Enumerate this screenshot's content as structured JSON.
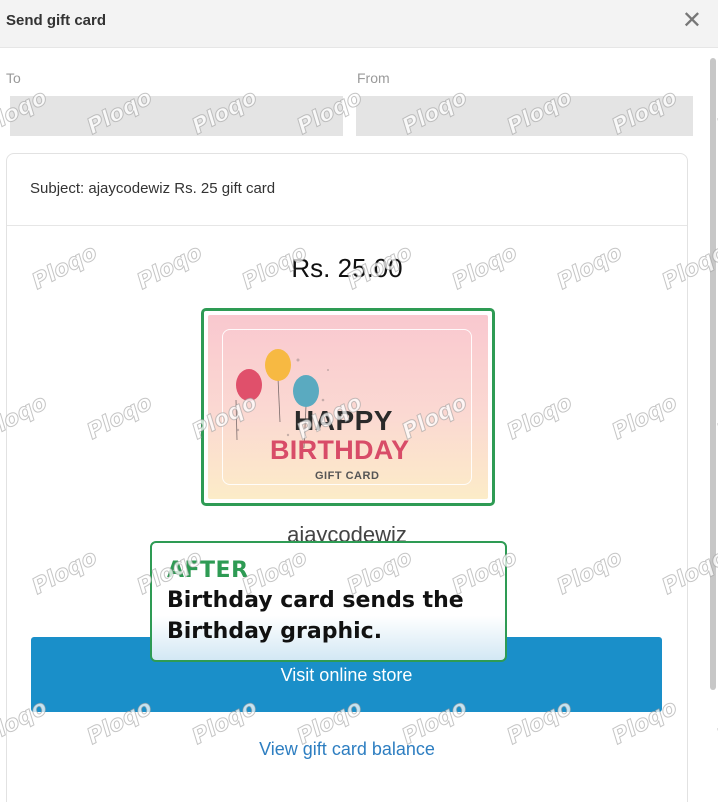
{
  "dialog": {
    "title": "Send gift card",
    "close_icon": "close-icon"
  },
  "form": {
    "to_label": "To",
    "to_value": "",
    "from_label": "From",
    "from_value": ""
  },
  "email_preview": {
    "subject": "Subject: ajaycodewiz Rs. 25 gift card",
    "amount": "Rs. 25.00",
    "gift_card": {
      "happy": "HAPPY",
      "birthday": "BIRTHDAY",
      "label": "GIFT CARD",
      "balloon_colors": [
        "#e0506b",
        "#f7b942",
        "#5aaac0"
      ]
    },
    "store_name": "ajaycodewiz",
    "visit_button": "Visit online store",
    "balance_link": "View gift card balance"
  },
  "annotation": {
    "tag": "AFTER",
    "note": "Birthday card sends the Birthday graphic.",
    "border_color": "#2e9b54"
  },
  "watermark": {
    "text": "Ploqo"
  },
  "colors": {
    "button": "#1a8fc9",
    "link": "#2d7ec1",
    "highlight": "#2e9b54"
  }
}
